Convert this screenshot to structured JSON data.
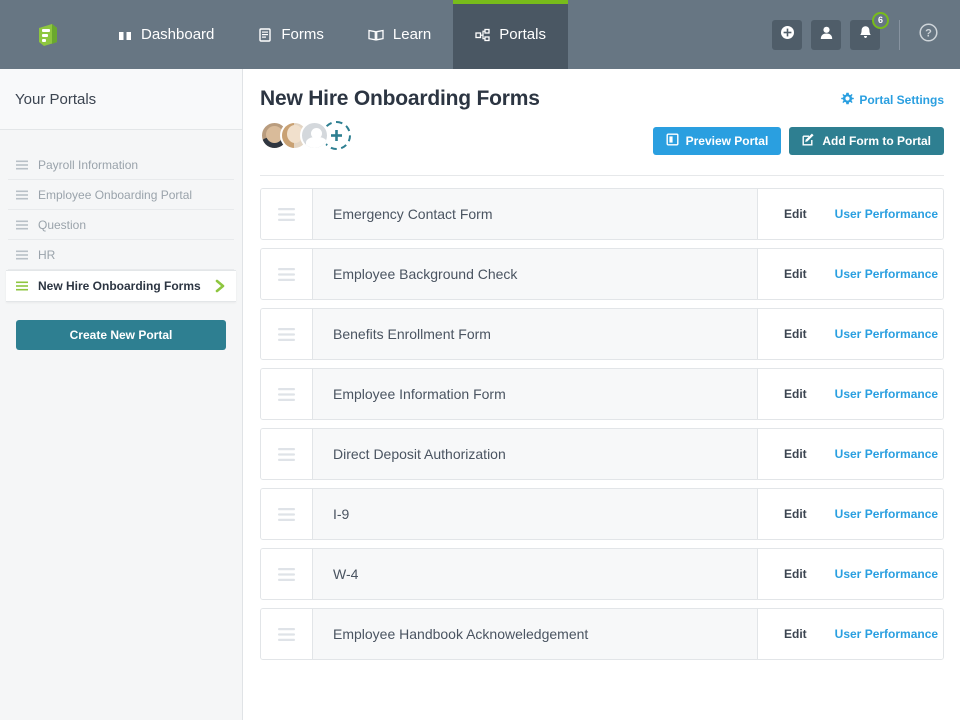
{
  "topnav": {
    "logo": "jotform-logo",
    "items": [
      {
        "label": "Dashboard",
        "icon": "dashboard-icon",
        "active": false
      },
      {
        "label": "Forms",
        "icon": "forms-icon",
        "active": false
      },
      {
        "label": "Learn",
        "icon": "book-icon",
        "active": false
      },
      {
        "label": "Portals",
        "icon": "sitemap-icon",
        "active": true
      }
    ],
    "actions": {
      "add_label": "plus-circle-icon",
      "account_label": "user-icon",
      "notifications_label": "bell-icon",
      "notification_count": "6",
      "help_label": "help-circle-icon"
    },
    "colors": {
      "bar": "#677683",
      "active_tab": "#4a5763",
      "accent_green": "#78bc1b"
    }
  },
  "sidebar": {
    "title": "Your Portals",
    "items": [
      {
        "label": "Payroll Information",
        "active": false
      },
      {
        "label": "Employee Onboarding Portal",
        "active": false
      },
      {
        "label": "Question",
        "active": false
      },
      {
        "label": "HR",
        "active": false
      },
      {
        "label": "New Hire Onboarding Forms",
        "active": true
      }
    ],
    "create_button": "Create New Portal",
    "colors": {
      "create_button_bg": "#2e7f91",
      "active_icon": "#8ec63f"
    }
  },
  "main": {
    "page_title": "New Hire Onboarding Forms",
    "portal_settings_label": "Portal Settings",
    "avatars": [
      {
        "name": "avatar-user-1"
      },
      {
        "name": "avatar-user-2"
      },
      {
        "name": "avatar-user-3-placeholder"
      }
    ],
    "add_user_label": "+",
    "buttons": {
      "preview": "Preview Portal",
      "add_form": "Add Form to Portal"
    },
    "actions": {
      "edit": "Edit",
      "performance": "User Performance"
    },
    "forms": [
      {
        "name": "Emergency Contact Form"
      },
      {
        "name": "Employee Background Check"
      },
      {
        "name": "Benefits Enrollment Form"
      },
      {
        "name": "Employee Information Form"
      },
      {
        "name": "Direct Deposit Authorization"
      },
      {
        "name": "I-9"
      },
      {
        "name": "W-4"
      },
      {
        "name": "Employee Handbook Acknoweledgement"
      }
    ],
    "colors": {
      "link_blue": "#2a9fe0",
      "teal": "#2e7f91",
      "row_bg": "#f7f8f9"
    }
  }
}
